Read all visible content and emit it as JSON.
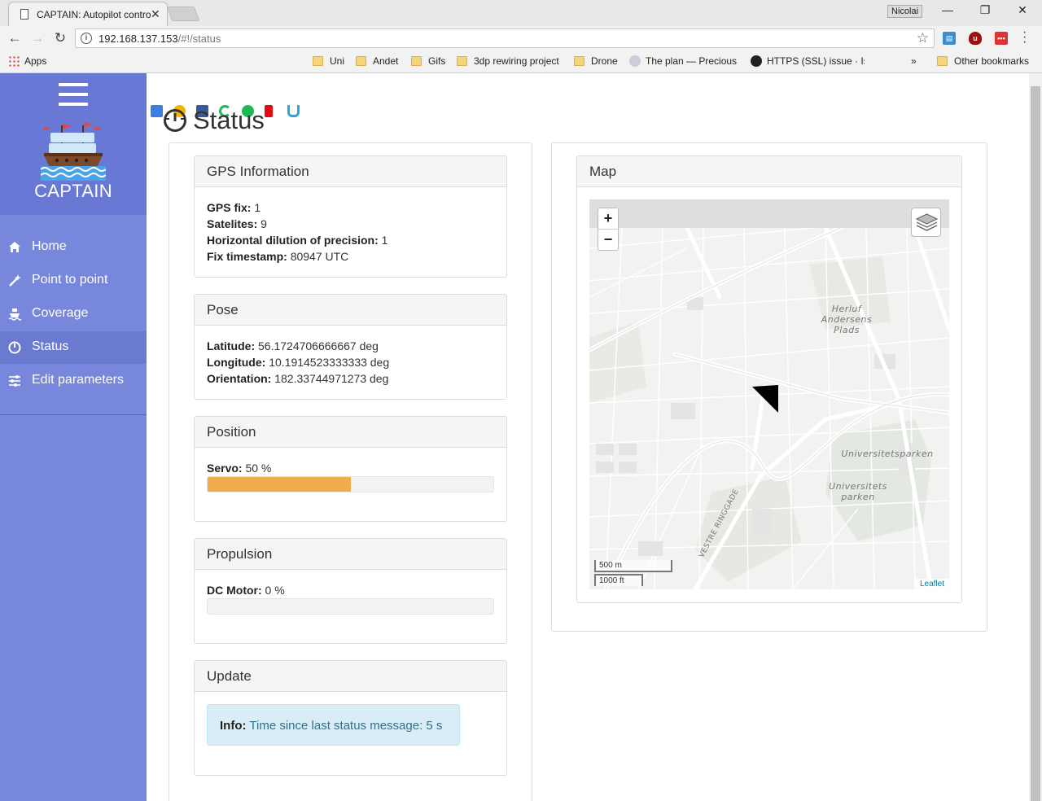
{
  "browser": {
    "tab_title": "CAPTAIN: Autopilot control",
    "profile_name": "Nicolai",
    "url_host": "192.168.137.153",
    "url_path": "/#!/status",
    "bookmarks": {
      "apps": "Apps",
      "uni": "Uni",
      "andet": "Andet",
      "gifs": "Gifs",
      "rewiring": "3dp rewiring project",
      "drone": "Drone",
      "the_plan": "The plan — Precious",
      "https_issue": "HTTPS (SSL) issue · Is",
      "more": "»",
      "other": "Other bookmarks"
    }
  },
  "sidebar": {
    "brand": "CAPTAIN",
    "items": [
      {
        "label": "Home",
        "icon": "home-icon"
      },
      {
        "label": "Point to point",
        "icon": "magic-wand-icon"
      },
      {
        "label": "Coverage",
        "icon": "ship-icon"
      },
      {
        "label": "Status",
        "icon": "gauge-icon"
      },
      {
        "label": "Edit parameters",
        "icon": "sliders-icon"
      }
    ],
    "active": "Status"
  },
  "page": {
    "title": "Status"
  },
  "gps": {
    "heading": "GPS Information",
    "fix_label": "GPS fix:",
    "fix_value": "1",
    "satellites_label": "Satelites:",
    "satellites_value": "9",
    "hdop_label": "Horizontal dilution of precision:",
    "hdop_value": "1",
    "timestamp_label": "Fix timestamp:",
    "timestamp_value": "80947 UTC"
  },
  "pose": {
    "heading": "Pose",
    "latitude_label": "Latitude:",
    "latitude_value": "56.1724706666667 deg",
    "longitude_label": "Longitude:",
    "longitude_value": "10.1914523333333 deg",
    "orientation_label": "Orientation:",
    "orientation_value": "182.33744971273 deg"
  },
  "position": {
    "heading": "Position",
    "servo_label": "Servo:",
    "servo_text": "50 %",
    "servo_fraction": 0.5
  },
  "propulsion": {
    "heading": "Propulsion",
    "motor_label": "DC Motor:",
    "motor_text": "0 %",
    "motor_fraction": 0
  },
  "update": {
    "heading": "Update",
    "info_label": "Info:",
    "info_text": "Time since last status message: 5 s"
  },
  "map": {
    "heading": "Map",
    "zoom_in": "+",
    "zoom_out": "−",
    "scale_metric": "500 m",
    "scale_imperial": "1000 ft",
    "attribution": "Leaflet",
    "labels": {
      "herluf": "Herluf Andersens Plads",
      "universitetsparken": "Universitetsparken",
      "universitets_parken": "Universitets parken",
      "vestre_ringgade": "VESTRE RINGGADE"
    }
  },
  "colors": {
    "sidebar": "#7787dc",
    "servo_bar": "#f0ad4e",
    "info_bg": "#d9edf7",
    "info_text": "#31708f"
  }
}
